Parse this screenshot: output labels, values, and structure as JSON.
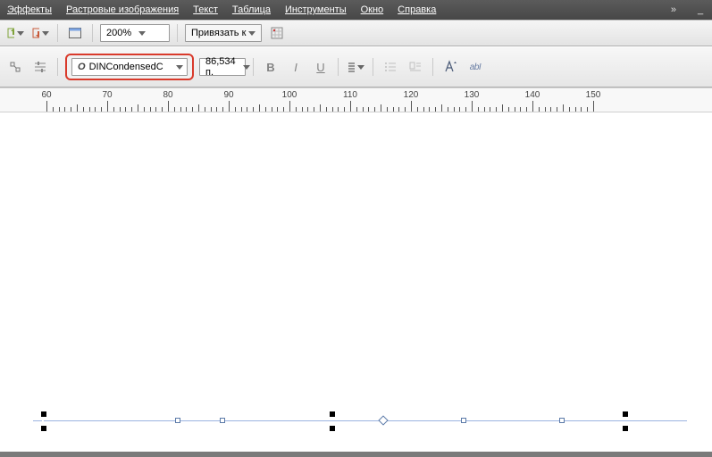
{
  "menu": {
    "effects": "Эффекты",
    "bitmap": "Растровые изображения",
    "text": "Текст",
    "table": "Таблица",
    "tools": "Инструменты",
    "window": "Окно",
    "help": "Справка"
  },
  "toolbar": {
    "zoom": "200%",
    "snap_label": "Привязать к"
  },
  "textbar": {
    "font_name": "DINCondensedC",
    "font_size": "86,534 п.",
    "text_frame_label": "abI"
  },
  "ruler": {
    "start": 60,
    "step": 10,
    "count": 10
  }
}
